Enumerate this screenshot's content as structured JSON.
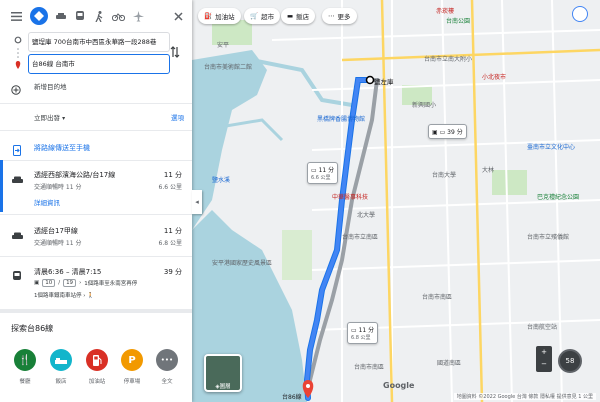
{
  "colors": {
    "accent": "#1a73e8",
    "route": "#4285f4",
    "alt_route": "#9aa0a6",
    "water": "#aad3df",
    "green": "#188038"
  },
  "modes": [
    "menu-icon",
    "driving-icon",
    "car-icon",
    "transit-icon",
    "walk-icon",
    "bike-icon",
    "flight-icon"
  ],
  "origin": {
    "value": "鹽埕庫 700台南市中西區永華路一段288巷"
  },
  "destination": {
    "value": "台86線 台南市"
  },
  "add_destination": "新增目的地",
  "depart": {
    "label": "立即出發",
    "options": "選項"
  },
  "send_to_phone": "將路線傳送至手機",
  "routes": [
    {
      "name": "透經西部濱海公路/台17線",
      "sub": "交通順暢時 11 分",
      "time": "11 分",
      "dist": "6.6 公里",
      "details": "詳細資訊"
    },
    {
      "name": "透經台17甲線",
      "sub": "交通順暢時 11 分",
      "time": "11 分",
      "dist": "6.8 公里"
    }
  ],
  "transit": {
    "name": "清晨6:36 – 清晨7:15",
    "time": "39 分",
    "bus1": "10",
    "bus2": "19",
    "step1": "1個路車至永南宮再停",
    "step2": "1個路車鐵南車站停"
  },
  "explore": {
    "title": "探索台86線",
    "items": [
      {
        "label": "餐廳",
        "color": "#188038",
        "icon": "fork-knife-icon",
        "glyph": "🍴"
      },
      {
        "label": "飯店",
        "color": "#12b5cb",
        "icon": "bed-icon",
        "glyph": "▬"
      },
      {
        "label": "加油站",
        "color": "#d93025",
        "icon": "gas-station-icon",
        "glyph": "⛽"
      },
      {
        "label": "停車場",
        "color": "#f29900",
        "icon": "parking-icon",
        "glyph": "P"
      },
      {
        "label": "全文",
        "color": "#70757a",
        "icon": "more-icon",
        "glyph": "•••"
      }
    ]
  },
  "map": {
    "chips": [
      {
        "label": "加油站",
        "icon": "gas-icon"
      },
      {
        "label": "超市",
        "icon": "cart-icon"
      },
      {
        "label": "飯店",
        "icon": "bed-icon"
      },
      {
        "label": "更多",
        "icon": "more-icon"
      }
    ],
    "callouts": [
      {
        "time": "11 分",
        "dist": "6.6 公里"
      },
      {
        "time": "11 分",
        "dist": "6.8 公里"
      },
      {
        "time": "39 分"
      }
    ],
    "origin_label": "鹽左庫",
    "dest_label": "台86線",
    "labels": [
      "赤崁樓",
      "台南公園",
      "台南市立南大附小",
      "臺南市立文化中心",
      "台南市美術館二館",
      "台南大學",
      "黑橋牌香腸博物館",
      "中華醫事科技",
      "大林",
      "巴克禮紀念公園",
      "台南市立殯儀館",
      "台南航空站",
      "安平",
      "台南市南區",
      "鹽水溪",
      "北大學",
      "安平港國家歷史風景區",
      "台南市立南區",
      "國道南區",
      "新興國小",
      "台南市南區",
      "小北夜市"
    ],
    "satellite": "圖層",
    "speed": "58",
    "attribution": "地圖資料 ©2022 Google 台灣 條款 隱私權 提供意見",
    "scale": "1 公里",
    "zoom_labels": [
      "+",
      "−"
    ]
  }
}
